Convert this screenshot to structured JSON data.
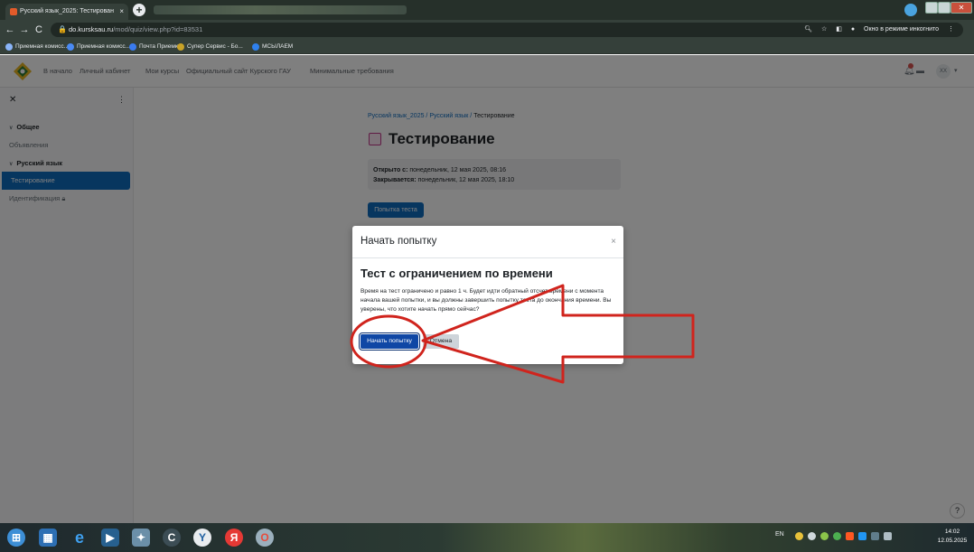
{
  "browser": {
    "tab_title": "Русский язык_2025: Тестирован",
    "tab_close": "×",
    "new_tab": "+",
    "url_host": "do.kursksau.ru",
    "url_path": "/mod/quiz/view.php?id=83531",
    "incognito_label": "Окно в режиме инкогнито",
    "bookmarks": [
      "Приемная комисс...",
      "Приемная комисс...",
      "Почта Приемка",
      "Супер Сервис - Бо...",
      "МСЫЛАЕМ"
    ]
  },
  "nav": {
    "links": [
      "В начало",
      "Личный кабинет",
      "Мои курсы",
      "Официальный сайт Курского ГАУ",
      "Минимальные требования"
    ],
    "avatar_initials": "XX"
  },
  "drawer": {
    "items": [
      {
        "label": "Общее",
        "kind": "section"
      },
      {
        "label": "Объявления",
        "kind": "sub"
      },
      {
        "label": "Русский язык",
        "kind": "section"
      },
      {
        "label": "Тестирование",
        "kind": "active"
      },
      {
        "label": "Идентификация",
        "kind": "sub"
      }
    ]
  },
  "page": {
    "breadcrumb": [
      "Русский язык_2025",
      "Русский язык",
      "Тестирование"
    ],
    "title": "Тестирование",
    "opened_label": "Открыто с:",
    "opened_value": "понедельник, 12 мая 2025, 08:16",
    "closes_label": "Закрывается:",
    "closes_value": "понедельник, 12 мая 2025, 18:10",
    "attempt_button": "Попытка теста",
    "help": "?"
  },
  "modal": {
    "title": "Начать попытку",
    "close": "×",
    "heading": "Тест с ограничением по времени",
    "body": "Время на тест ограничено и равно 1 ч. Будет идти обратный отсчет времени с момента начала вашей попытки, и вы должны завершить попытку теста до окончания времени. Вы уверены, что хотите начать прямо сейчас?",
    "start_button": "Начать попытку",
    "cancel_button": "Отмена"
  },
  "taskbar": {
    "lang": "EN",
    "time": "14:02",
    "date": "12.05.2025"
  },
  "colors": {
    "primary": "#0f6cbf",
    "annotation": "#d0241d"
  }
}
